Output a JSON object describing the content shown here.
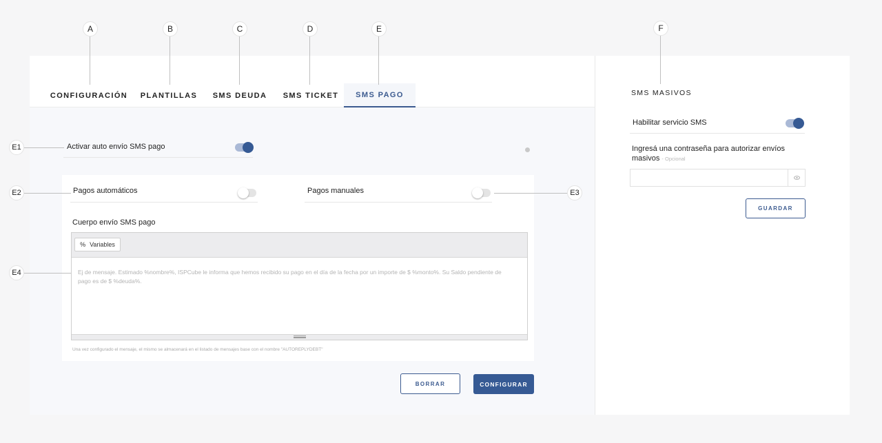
{
  "markers": {
    "A": "A",
    "B": "B",
    "C": "C",
    "D": "D",
    "E": "E",
    "F": "F",
    "E1": "E1",
    "E2": "E2",
    "E3": "E3",
    "E4": "E4"
  },
  "tabs": [
    {
      "label": "CONFIGURACIÓN"
    },
    {
      "label": "PLANTILLAS"
    },
    {
      "label": "SMS DEUDA"
    },
    {
      "label": "SMS TICKET"
    },
    {
      "label": "SMS PAGO"
    }
  ],
  "active_tab": "SMS PAGO",
  "sms_pago": {
    "auto_send_label": "Activar auto envío SMS pago",
    "auto_send_on": true,
    "pagos_automaticos_label": "Pagos automáticos",
    "pagos_automaticos_on": false,
    "pagos_manuales_label": "Pagos manuales",
    "pagos_manuales_on": false,
    "body_label": "Cuerpo envío SMS pago",
    "variables_icon": "%",
    "variables_label": "Variables",
    "message_placeholder": "Ej de mensaje. Estimado %nombre%, ISPCube le informa que hemos recibido su pago en el día de la fecha por un importe de $ %monto%. Su Saldo pendiente de pago es de $ %deuda%.",
    "footnote": "Una vez configurado el mensaje, el mismo se almacenará en el listado de mensajes base con el nombre \"AUTOREPLYDEBT\"",
    "clear_button": "BORRAR",
    "configure_button": "CONFIGURAR"
  },
  "sms_masivos": {
    "title": "SMS MASIVOS",
    "enable_label": "Habilitar servicio SMS",
    "enable_on": true,
    "password_label": "Ingresá una contraseña para autorizar envíos masivos",
    "optional_label": "- Opcional",
    "password_value": "",
    "save_button": "GUARDAR"
  },
  "colors": {
    "accent": "#365a94",
    "toggle_track_on": "#aab9d6",
    "background": "#f6f6f7"
  }
}
